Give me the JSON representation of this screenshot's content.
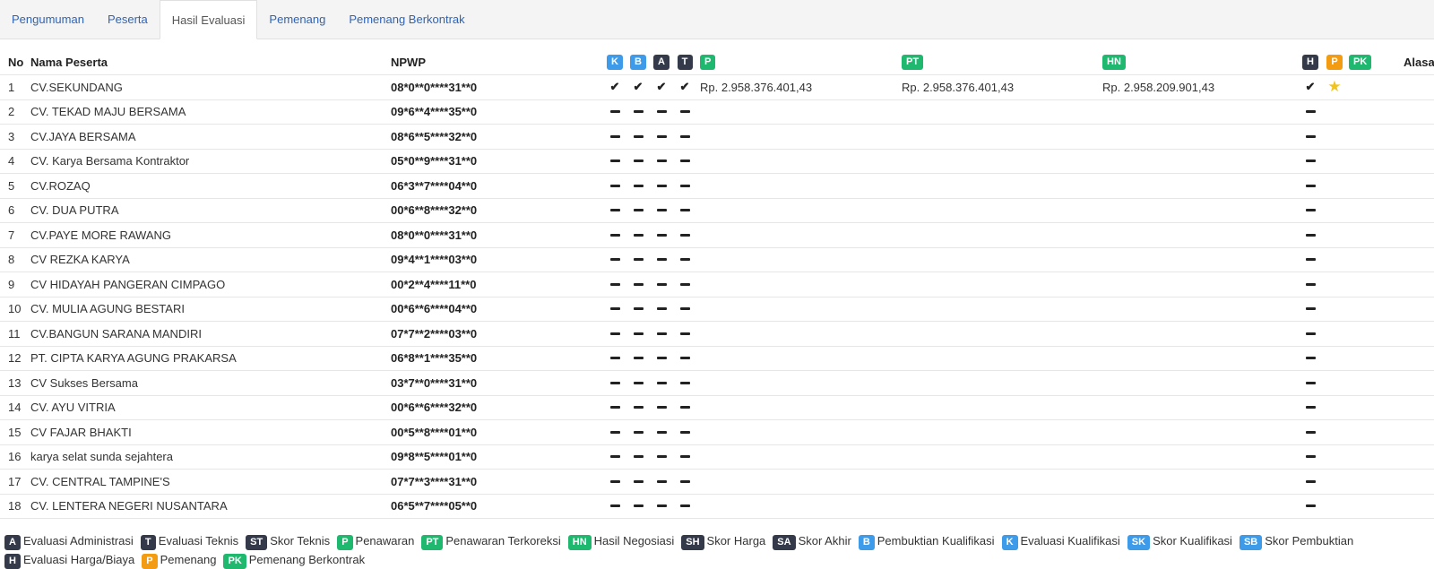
{
  "tabs": [
    {
      "label": "Pengumuman",
      "active": false
    },
    {
      "label": "Peserta",
      "active": false
    },
    {
      "label": "Hasil Evaluasi",
      "active": true
    },
    {
      "label": "Pemenang",
      "active": false
    },
    {
      "label": "Pemenang Berkontrak",
      "active": false
    }
  ],
  "table": {
    "headers": {
      "no": "No",
      "nama": "Nama Peserta",
      "npwp": "NPWP",
      "k": "K",
      "b": "B",
      "a": "A",
      "t": "T",
      "p": "P",
      "pt": "PT",
      "hn": "HN",
      "h": "H",
      "pemenang": "P",
      "pk": "PK",
      "alasan": "Alasan"
    },
    "rows": [
      {
        "no": "1",
        "nama": "CV.SEKUNDANG",
        "npwp": "08*0**0****31**0",
        "k": "check",
        "b": "check",
        "a": "check",
        "t": "check",
        "p": "Rp. 2.958.376.401,43",
        "pt": "Rp. 2.958.376.401,43",
        "hn": "Rp. 2.958.209.901,43",
        "h": "check",
        "pemenang": "star"
      },
      {
        "no": "2",
        "nama": "CV. TEKAD MAJU BERSAMA",
        "npwp": "09*6**4****35**0",
        "k": "dash",
        "b": "dash",
        "a": "dash",
        "t": "dash",
        "p": "",
        "pt": "",
        "hn": "",
        "h": "dash",
        "pemenang": ""
      },
      {
        "no": "3",
        "nama": "CV.JAYA BERSAMA",
        "npwp": "08*6**5****32**0",
        "k": "dash",
        "b": "dash",
        "a": "dash",
        "t": "dash",
        "p": "",
        "pt": "",
        "hn": "",
        "h": "dash",
        "pemenang": ""
      },
      {
        "no": "4",
        "nama": "CV. Karya Bersama Kontraktor",
        "npwp": "05*0**9****31**0",
        "k": "dash",
        "b": "dash",
        "a": "dash",
        "t": "dash",
        "p": "",
        "pt": "",
        "hn": "",
        "h": "dash",
        "pemenang": ""
      },
      {
        "no": "5",
        "nama": "CV.ROZAQ",
        "npwp": "06*3**7****04**0",
        "k": "dash",
        "b": "dash",
        "a": "dash",
        "t": "dash",
        "p": "",
        "pt": "",
        "hn": "",
        "h": "dash",
        "pemenang": ""
      },
      {
        "no": "6",
        "nama": "CV. DUA PUTRA",
        "npwp": "00*6**8****32**0",
        "k": "dash",
        "b": "dash",
        "a": "dash",
        "t": "dash",
        "p": "",
        "pt": "",
        "hn": "",
        "h": "dash",
        "pemenang": ""
      },
      {
        "no": "7",
        "nama": "CV.PAYE MORE RAWANG",
        "npwp": "08*0**0****31**0",
        "k": "dash",
        "b": "dash",
        "a": "dash",
        "t": "dash",
        "p": "",
        "pt": "",
        "hn": "",
        "h": "dash",
        "pemenang": ""
      },
      {
        "no": "8",
        "nama": "CV REZKA KARYA",
        "npwp": "09*4**1****03**0",
        "k": "dash",
        "b": "dash",
        "a": "dash",
        "t": "dash",
        "p": "",
        "pt": "",
        "hn": "",
        "h": "dash",
        "pemenang": ""
      },
      {
        "no": "9",
        "nama": "CV HIDAYAH PANGERAN CIMPAGO",
        "npwp": "00*2**4****11**0",
        "k": "dash",
        "b": "dash",
        "a": "dash",
        "t": "dash",
        "p": "",
        "pt": "",
        "hn": "",
        "h": "dash",
        "pemenang": ""
      },
      {
        "no": "10",
        "nama": "CV. MULIA AGUNG BESTARI",
        "npwp": "00*6**6****04**0",
        "k": "dash",
        "b": "dash",
        "a": "dash",
        "t": "dash",
        "p": "",
        "pt": "",
        "hn": "",
        "h": "dash",
        "pemenang": ""
      },
      {
        "no": "11",
        "nama": "CV.BANGUN SARANA MANDIRI",
        "npwp": "07*7**2****03**0",
        "k": "dash",
        "b": "dash",
        "a": "dash",
        "t": "dash",
        "p": "",
        "pt": "",
        "hn": "",
        "h": "dash",
        "pemenang": ""
      },
      {
        "no": "12",
        "nama": "PT. CIPTA KARYA AGUNG PRAKARSA",
        "npwp": "06*8**1****35**0",
        "k": "dash",
        "b": "dash",
        "a": "dash",
        "t": "dash",
        "p": "",
        "pt": "",
        "hn": "",
        "h": "dash",
        "pemenang": ""
      },
      {
        "no": "13",
        "nama": "CV Sukses Bersama",
        "npwp": "03*7**0****31**0",
        "k": "dash",
        "b": "dash",
        "a": "dash",
        "t": "dash",
        "p": "",
        "pt": "",
        "hn": "",
        "h": "dash",
        "pemenang": ""
      },
      {
        "no": "14",
        "nama": "CV. AYU VITRIA",
        "npwp": "00*6**6****32**0",
        "k": "dash",
        "b": "dash",
        "a": "dash",
        "t": "dash",
        "p": "",
        "pt": "",
        "hn": "",
        "h": "dash",
        "pemenang": ""
      },
      {
        "no": "15",
        "nama": "CV FAJAR BHAKTI",
        "npwp": "00*5**8****01**0",
        "k": "dash",
        "b": "dash",
        "a": "dash",
        "t": "dash",
        "p": "",
        "pt": "",
        "hn": "",
        "h": "dash",
        "pemenang": ""
      },
      {
        "no": "16",
        "nama": "karya selat sunda sejahtera",
        "npwp": "09*8**5****01**0",
        "k": "dash",
        "b": "dash",
        "a": "dash",
        "t": "dash",
        "p": "",
        "pt": "",
        "hn": "",
        "h": "dash",
        "pemenang": ""
      },
      {
        "no": "17",
        "nama": "CV. CENTRAL TAMPINE'S",
        "npwp": "07*7**3****31**0",
        "k": "dash",
        "b": "dash",
        "a": "dash",
        "t": "dash",
        "p": "",
        "pt": "",
        "hn": "",
        "h": "dash",
        "pemenang": ""
      },
      {
        "no": "18",
        "nama": "CV. LENTERA NEGERI NUSANTARA",
        "npwp": "06*5**7****05**0",
        "k": "dash",
        "b": "dash",
        "a": "dash",
        "t": "dash",
        "p": "",
        "pt": "",
        "hn": "",
        "h": "dash",
        "pemenang": ""
      }
    ]
  },
  "legend": [
    {
      "code": "A",
      "label": "Evaluasi Administrasi",
      "color": "dark"
    },
    {
      "code": "T",
      "label": "Evaluasi Teknis",
      "color": "dark"
    },
    {
      "code": "ST",
      "label": "Skor Teknis",
      "color": "dark"
    },
    {
      "code": "P",
      "label": "Penawaran",
      "color": "green"
    },
    {
      "code": "PT",
      "label": "Penawaran Terkoreksi",
      "color": "green"
    },
    {
      "code": "HN",
      "label": "Hasil Negosiasi",
      "color": "green"
    },
    {
      "code": "SH",
      "label": "Skor Harga",
      "color": "dark"
    },
    {
      "code": "SA",
      "label": "Skor Akhir",
      "color": "dark"
    },
    {
      "code": "B",
      "label": "Pembuktian Kualifikasi",
      "color": "blue"
    },
    {
      "code": "K",
      "label": "Evaluasi Kualifikasi",
      "color": "blue"
    },
    {
      "code": "SK",
      "label": "Skor Kualifikasi",
      "color": "blue"
    },
    {
      "code": "SB",
      "label": "Skor Pembuktian",
      "color": "blue"
    },
    {
      "code": "H",
      "label": "Evaluasi Harga/Biaya",
      "color": "dark"
    },
    {
      "code": "P",
      "label": "Pemenang",
      "color": "orange"
    },
    {
      "code": "PK",
      "label": "Pemenang Berkontrak",
      "color": "green"
    }
  ],
  "colors": {
    "blue": "#3d9be9",
    "dark": "#343a4a",
    "green": "#1fb86f",
    "orange": "#f39c12",
    "link": "#2f63b5"
  },
  "icons": {
    "check": "check-icon",
    "dash": "dash-icon",
    "star": "star-icon"
  }
}
